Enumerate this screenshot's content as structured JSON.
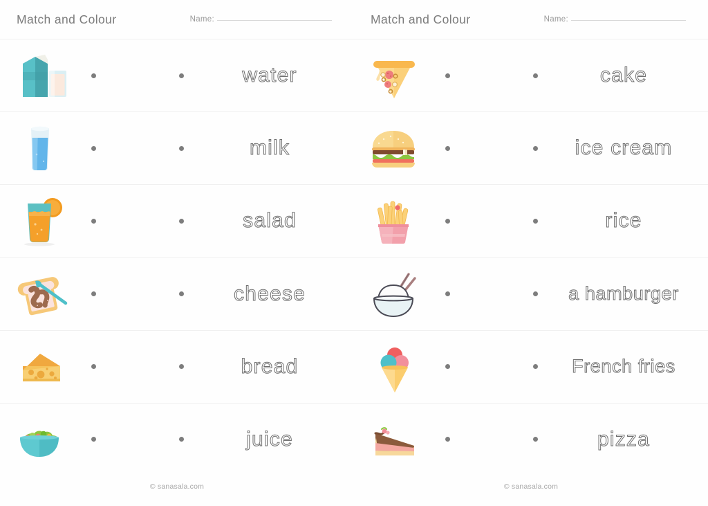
{
  "worksheet": {
    "title": "Match and Colour",
    "name_label": "Name:",
    "copyright": "© sanasala.com"
  },
  "sheets": [
    {
      "id": "left",
      "title": "Match and Colour",
      "name_label": "Name:",
      "copyright": "© sanasala.com",
      "rows": [
        {
          "icon": "milk-carton-and-glass-icon",
          "word": "water"
        },
        {
          "icon": "glass-of-water-icon",
          "word": "milk"
        },
        {
          "icon": "orange-juice-glass-icon",
          "word": "salad"
        },
        {
          "icon": "bread-with-spread-icon",
          "word": "cheese"
        },
        {
          "icon": "cheese-wedge-icon",
          "word": "bread"
        },
        {
          "icon": "salad-bowl-icon",
          "word": "juice"
        }
      ]
    },
    {
      "id": "right",
      "title": "Match and Colour",
      "name_label": "Name:",
      "copyright": "© sanasala.com",
      "rows": [
        {
          "icon": "pizza-slice-icon",
          "word": "cake"
        },
        {
          "icon": "hamburger-icon",
          "word": "ice cream"
        },
        {
          "icon": "french-fries-icon",
          "word": "rice"
        },
        {
          "icon": "rice-bowl-icon",
          "word": "a hamburger"
        },
        {
          "icon": "ice-cream-cone-icon",
          "word": "French fries"
        },
        {
          "icon": "cake-slice-icon",
          "word": "pizza"
        }
      ]
    }
  ],
  "colors": {
    "title_text": "#7c7c7c",
    "label_text": "#9a9a9a",
    "dot": "#7d7d7d",
    "word_outline": "#6f6f6f",
    "row_divider": "#f0f0f0",
    "page_background": "#fefefe",
    "teal": "#4db6bd",
    "orange": "#f5a623",
    "pink": "#f08a96",
    "blue": "#5bb8e8",
    "brown": "#8d5a3b",
    "cheese_yellow": "#f6c863"
  }
}
